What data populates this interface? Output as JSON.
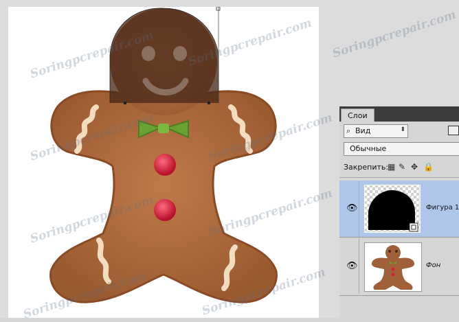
{
  "watermark_text": "Soringpcrepair.com",
  "layers_panel": {
    "tab_label": "Слои",
    "filter_label": "Вид",
    "blend_mode": "Обычные",
    "lock_label": "Закрепить:",
    "layers": [
      {
        "name": "Фигура 1",
        "selected": true
      },
      {
        "name": "Фон",
        "selected": false
      }
    ]
  },
  "colors": {
    "selection": "#aec6ea",
    "cookie": "#b06a40",
    "head_overlay": "#4a2a1a",
    "bow": "#6aa234",
    "button": "#d81e3a"
  }
}
